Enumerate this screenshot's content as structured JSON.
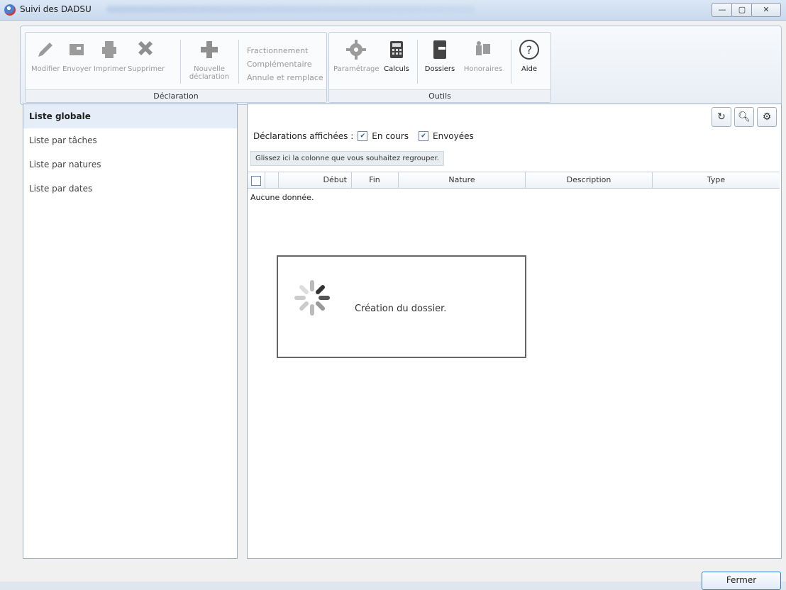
{
  "window": {
    "title": "Suivi des DADSU",
    "min": "—",
    "max": "▢",
    "close": "✕"
  },
  "ribbon": {
    "declaration": {
      "caption": "Déclaration",
      "buttons": [
        {
          "label": "Modifier",
          "icon": "pencil-icon"
        },
        {
          "label": "Envoyer",
          "icon": "send-icon"
        },
        {
          "label": "Imprimer",
          "icon": "printer-icon"
        },
        {
          "label": "Supprimer",
          "icon": "delete-icon"
        },
        {
          "label": "Nouvelle déclaration",
          "icon": "plus-icon"
        }
      ],
      "links": [
        "Fractionnement",
        "Complémentaire",
        "Annule et remplace"
      ]
    },
    "outils": {
      "caption": "Outils",
      "buttons": [
        {
          "label": "Paramétrage",
          "icon": "gear-icon"
        },
        {
          "label": "Calculs",
          "icon": "calculator-icon"
        },
        {
          "label": "Dossiers",
          "icon": "folder-icon"
        },
        {
          "label": "Honoraires",
          "icon": "fees-icon"
        },
        {
          "label": "Aide",
          "icon": "help-icon"
        }
      ]
    }
  },
  "left_panel": {
    "items": [
      "Liste globale",
      "Liste par tâches",
      "Liste par natures",
      "Liste par dates"
    ]
  },
  "right_panel": {
    "filters": {
      "label": "Déclarations affichées :",
      "en_cours": "En cours",
      "envoyees": "Envoyées"
    },
    "group_hint": "Glissez ici la colonne que vous souhaitez regrouper.",
    "columns": [
      "Début",
      "Fin",
      "Nature",
      "Description",
      "Type"
    ],
    "empty": "Aucune donnée."
  },
  "loading": {
    "text": "Création du dossier."
  },
  "footer": {
    "close_label": "Fermer"
  }
}
